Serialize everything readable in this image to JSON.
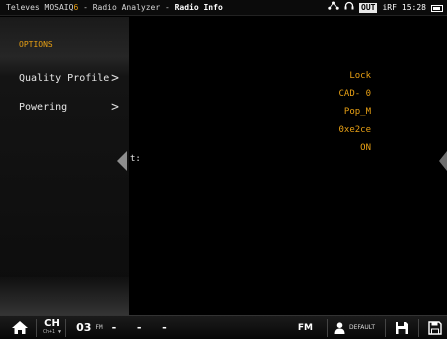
{
  "titlebar": {
    "brand_prefix": "Televes MOSAIQ",
    "brand_suffix": "6",
    "app_part": " - Radio Analyzer - ",
    "page_title": "Radio Info",
    "output_label": "OUT",
    "input_label": "iRF",
    "time": "15:28"
  },
  "sidebar": {
    "heading": "OPTIONS",
    "items": [
      {
        "label": "Quality Profile",
        "chevron": ">"
      },
      {
        "label": "Powering",
        "chevron": ">"
      }
    ]
  },
  "main": {
    "truncated_label": "t:",
    "values": [
      "Lock",
      "CAD-  0",
      "Pop_M",
      "0xe2ce",
      "ON"
    ]
  },
  "statusbar": {
    "ch_label": "CH",
    "ch_sublabel": "Ch+1 ▼",
    "channel_number": "03",
    "band_small": "FM",
    "dashes": "- - -",
    "band_large": "FM",
    "profile": "DEFAULT"
  },
  "colors": {
    "accent": "#e8a014",
    "background": "#000000"
  },
  "icons": [
    "network-icon",
    "headphones-icon",
    "battery-icon",
    "home-icon",
    "user-icon",
    "save-icon",
    "save-as-icon"
  ]
}
